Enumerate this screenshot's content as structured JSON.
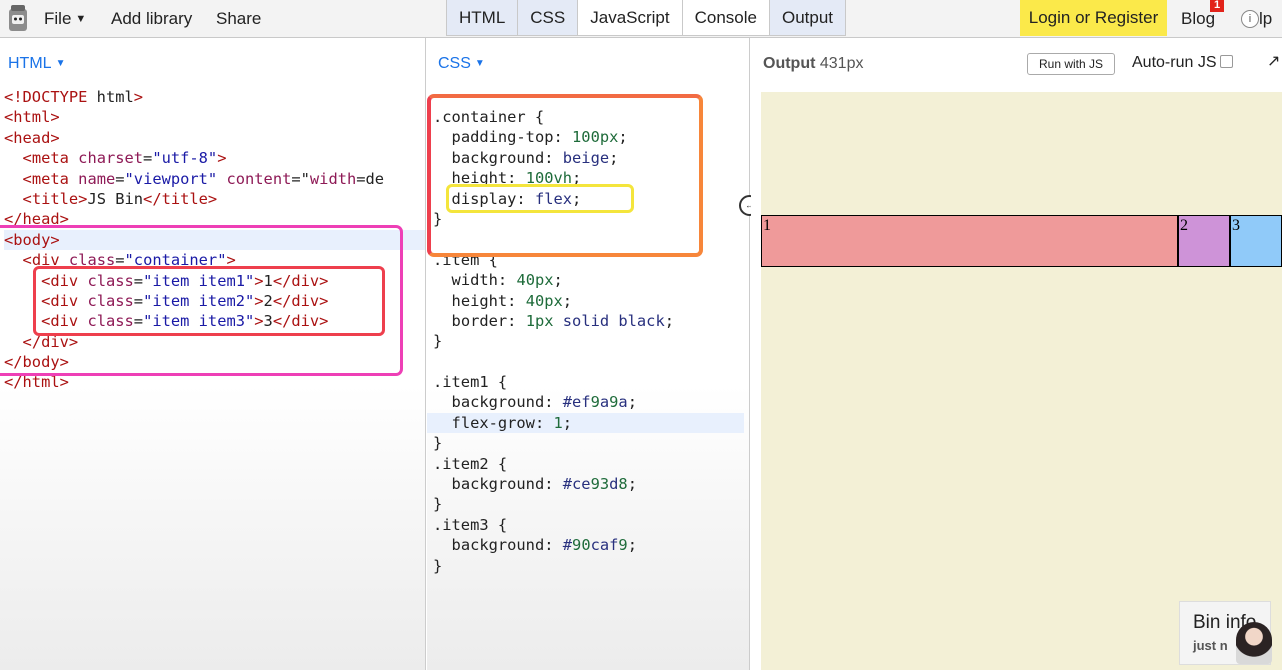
{
  "topbar": {
    "menu": {
      "file": "File",
      "add_library": "Add library",
      "share": "Share"
    },
    "tabs": [
      {
        "label": "HTML",
        "active": true
      },
      {
        "label": "CSS",
        "active": true
      },
      {
        "label": "JavaScript",
        "active": false
      },
      {
        "label": "Console",
        "active": false
      },
      {
        "label": "Output",
        "active": true
      }
    ],
    "login": "Login or Register",
    "blog": "Blog",
    "blog_badge": "1",
    "help_icon": "i",
    "help_tail": "lp"
  },
  "html_panel": {
    "title": "HTML",
    "lines": [
      {
        "t": "<!DOCTYPE html>",
        "hl": false
      },
      {
        "t": "<html>",
        "hl": false
      },
      {
        "t": "<head>",
        "hl": false
      },
      {
        "t": "  <meta charset=\"utf-8\">",
        "hl": false
      },
      {
        "t": "  <meta name=\"viewport\" content=\"width=de",
        "hl": false
      },
      {
        "t": "  <title>JS Bin</title>",
        "hl": false
      },
      {
        "t": "</head>",
        "hl": false
      },
      {
        "t": "<body>",
        "hl": true
      },
      {
        "t": "  <div class=\"container\">",
        "hl": false
      },
      {
        "t": "    <div class=\"item item1\">1</div>",
        "hl": false
      },
      {
        "t": "    <div class=\"item item2\">2</div>",
        "hl": false
      },
      {
        "t": "    <div class=\"item item3\">3</div>",
        "hl": false
      },
      {
        "t": "  </div>",
        "hl": false
      },
      {
        "t": "</body>",
        "hl": false
      },
      {
        "t": "</html>",
        "hl": false
      }
    ]
  },
  "css_panel": {
    "title": "CSS",
    "lines": [
      {
        "t": ".container {",
        "hl": false
      },
      {
        "t": "  padding-top: 100px;",
        "hl": false
      },
      {
        "t": "  background: beige;",
        "hl": false
      },
      {
        "t": "  height: 100vh;",
        "hl": false
      },
      {
        "t": "  display: flex;",
        "hl": false
      },
      {
        "t": "}",
        "hl": false
      },
      {
        "t": "",
        "hl": false
      },
      {
        "t": ".item {",
        "hl": false
      },
      {
        "t": "  width: 40px;",
        "hl": false
      },
      {
        "t": "  height: 40px;",
        "hl": false
      },
      {
        "t": "  border: 1px solid black;",
        "hl": false
      },
      {
        "t": "}",
        "hl": false
      },
      {
        "t": "",
        "hl": false
      },
      {
        "t": ".item1 {",
        "hl": false
      },
      {
        "t": "  background: #ef9a9a;",
        "hl": false
      },
      {
        "t": "  flex-grow: 1;",
        "hl": true
      },
      {
        "t": "}",
        "hl": false
      },
      {
        "t": ".item2 {",
        "hl": false
      },
      {
        "t": "  background: #ce93d8;",
        "hl": false
      },
      {
        "t": "}",
        "hl": false
      },
      {
        "t": ".item3 {",
        "hl": false
      },
      {
        "t": "  background: #90caf9;",
        "hl": false
      },
      {
        "t": "}",
        "hl": false
      }
    ]
  },
  "output_panel": {
    "label": "Output",
    "width_label": "431px",
    "run_js": "Run with JS",
    "autorun": "Auto-run JS",
    "expand_icon": "↗",
    "items": [
      {
        "label": "1",
        "color": "#ef9a9a",
        "flex_grow": 1
      },
      {
        "label": "2",
        "color": "#ce93d8",
        "flex_grow": 0
      },
      {
        "label": "3",
        "color": "#90caf9",
        "flex_grow": 0
      }
    ],
    "container_color": "#f5f5dc"
  },
  "annotation_colors": {
    "pink": "#ee3fb6",
    "red": "#ee3f4d",
    "orange": "#f7863a",
    "yellow": "#f4e53c"
  },
  "bin_info": {
    "title": "Bin info",
    "subtitle": "just n"
  }
}
